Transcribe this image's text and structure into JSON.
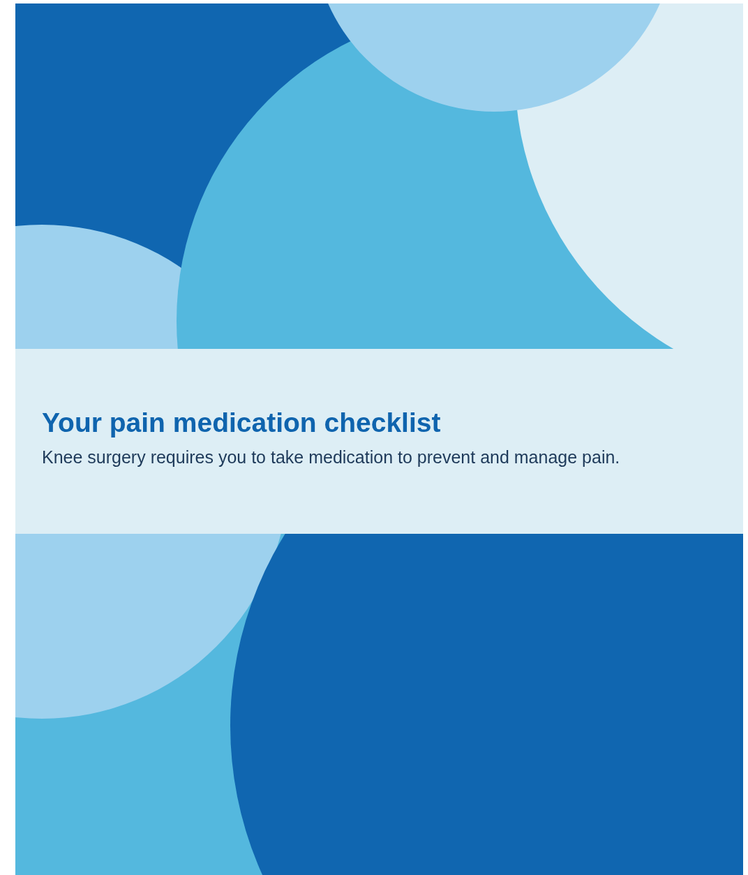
{
  "banner": {
    "title": "Your pain medication checklist",
    "subtitle": "Knee surgery requires you to take medication to prevent and manage pain."
  }
}
